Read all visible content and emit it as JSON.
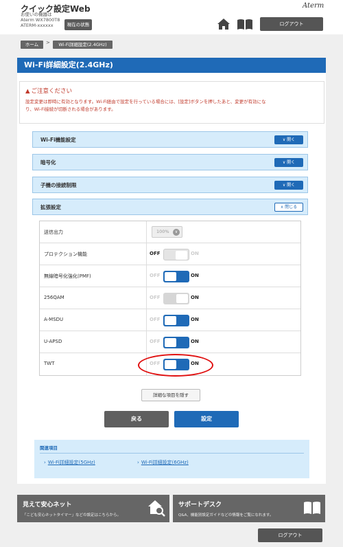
{
  "header": {
    "app_title": "クイック設定Web",
    "device_line1": "お使いの機器は",
    "device_line2": "Aterm WX7800T8",
    "device_line3": "ATERM-xxxxxx",
    "status_button": "現在の状態",
    "brand": "Aterm",
    "logout_button": "ログアウト"
  },
  "breadcrumb": {
    "home": "ホーム",
    "separator": ">",
    "current": "Wi-Fi詳細設定(2.4GHz)"
  },
  "page_title": "Wi-Fi詳細設定(2.4GHz)",
  "notice": {
    "title": "ご注意ください",
    "icon": "warning-icon",
    "line1": "設定変更は即時に有効となります。Wi-Fi経由で設定を行っている場合には、[設定]ボタンを押したあと、変更が有効にな",
    "line2": "り、Wi-Fi接続が切断される場合があります。"
  },
  "sections": [
    {
      "label": "Wi-Fi機能設定",
      "button": "開く"
    },
    {
      "label": "暗号化",
      "button": "開く"
    },
    {
      "label": "子機の接続制限",
      "button": "開く"
    },
    {
      "label": "拡張設定",
      "button": "閉じる"
    }
  ],
  "settings": {
    "tx_power": {
      "label": "送信出力",
      "value": "100%"
    },
    "protection": {
      "label": "プロテクション機能",
      "off": "OFF",
      "on": "ON",
      "state": "off"
    },
    "pmf": {
      "label": "無線暗号化強化(PMF)",
      "off": "OFF",
      "on": "ON",
      "state": "on"
    },
    "qam256": {
      "label": "256QAM",
      "off": "OFF",
      "on": "ON",
      "state": "disabled"
    },
    "amsdu": {
      "label": "A-MSDU",
      "off": "OFF",
      "on": "ON",
      "state": "on"
    },
    "uapsd": {
      "label": "U-APSD",
      "off": "OFF",
      "on": "ON",
      "state": "on"
    },
    "twt": {
      "label": "TWT",
      "off": "OFF",
      "on": "ON",
      "state": "on"
    }
  },
  "actions": {
    "hide_details": "詳細な項目を隠す",
    "back": "戻る",
    "save": "設定"
  },
  "related": {
    "title": "関連項目",
    "links": [
      "Wi-Fi詳細設定(5GHz)",
      "Wi-Fi詳細設定(6GHz)"
    ]
  },
  "banners": {
    "left_title": "見えて安心ネット",
    "left_sub": "「こども安心ネットタイマー」などの設定はこちらから。",
    "right_title": "サポートデスク",
    "right_sub": "Q&A、機能別設定ガイドなどの情報をご覧になれます。"
  },
  "footer": {
    "logout_button": "ログアウト"
  },
  "colors": {
    "accent": "#1f6ab7",
    "section_bg": "#d6ecfb",
    "warning": "#c0392b",
    "highlight": "#e01010"
  }
}
